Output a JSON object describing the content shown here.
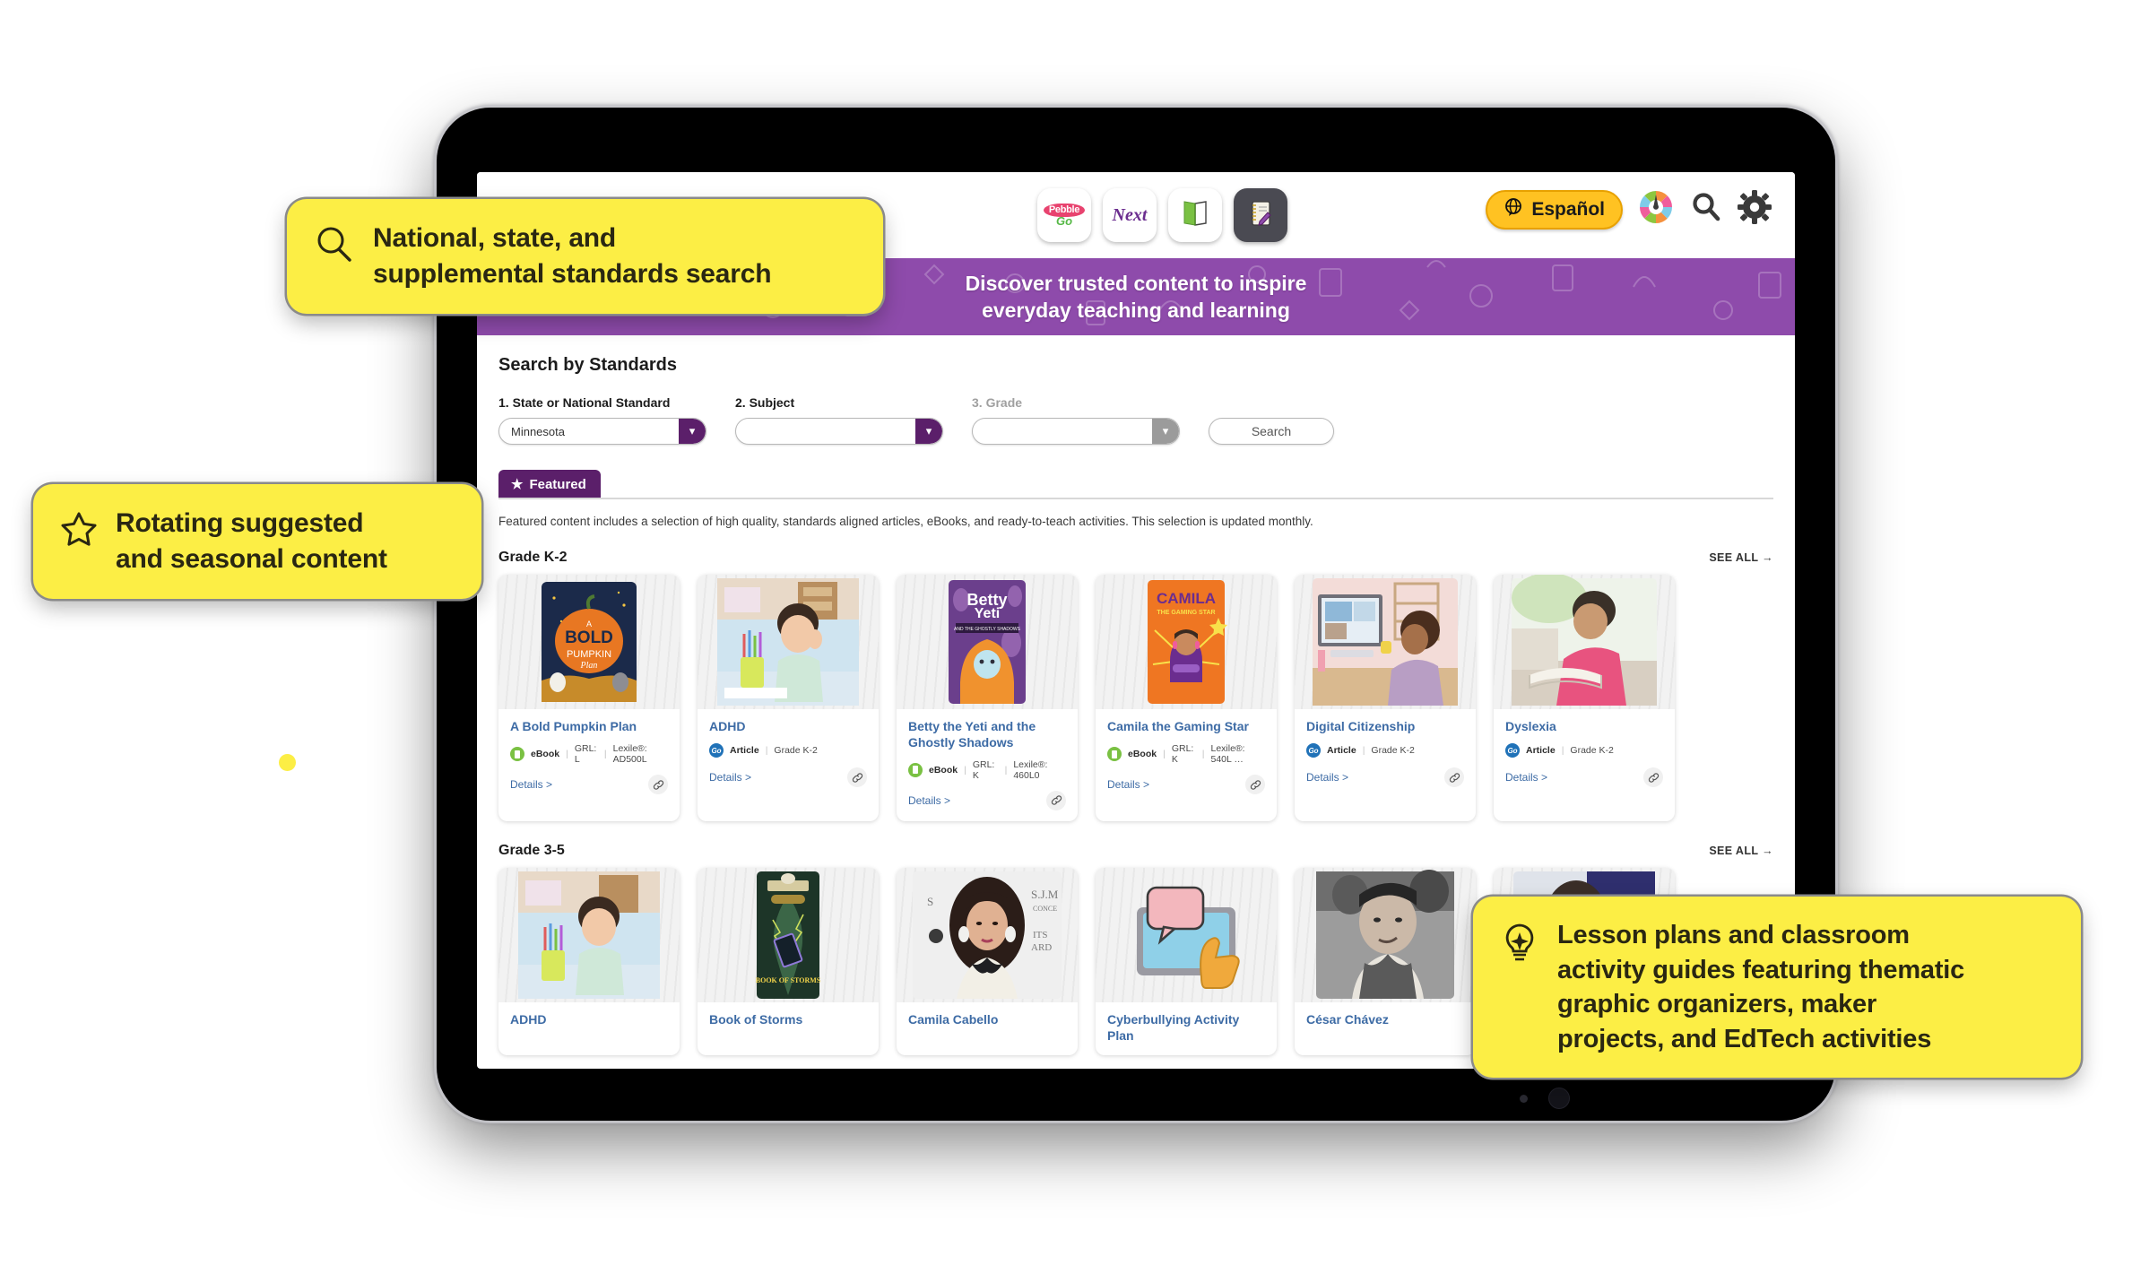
{
  "callouts": [
    {
      "id": "standards",
      "icon": "magnifier-icon",
      "lines": [
        "National, state, and",
        "supplemental standards search"
      ]
    },
    {
      "id": "rotating",
      "icon": "star-icon",
      "lines": [
        "Rotating suggested",
        "and seasonal content"
      ]
    },
    {
      "id": "lessons",
      "icon": "lightbulb-icon",
      "lines": [
        "Lesson plans and classroom",
        "activity guides featuring thematic",
        "graphic organizers, maker",
        "projects, and EdTech activities"
      ]
    }
  ],
  "header": {
    "brand_tiles": [
      {
        "name": "pebblego",
        "top": "Pebble",
        "bottom": "Go"
      },
      {
        "name": "next",
        "label": "Next"
      },
      {
        "name": "book",
        "label": ""
      },
      {
        "name": "notebook",
        "label": ""
      }
    ],
    "espanol_label": "Español",
    "icons": [
      "globe-icon",
      "color-wheel-icon",
      "search-icon",
      "gear-icon"
    ]
  },
  "hero": {
    "line1": "Discover trusted content to inspire",
    "line2": "everyday teaching and learning",
    "background_color": "#8e4bab"
  },
  "search_standards": {
    "title": "Search by Standards",
    "fields": [
      {
        "label": "1. State or National Standard",
        "value": "Minnesota",
        "placeholder": "",
        "disabled": false
      },
      {
        "label": "2. Subject",
        "value": "",
        "placeholder": "",
        "disabled": false
      },
      {
        "label": "3. Grade",
        "value": "",
        "placeholder": "",
        "disabled": true
      }
    ],
    "submit_label": "Search"
  },
  "featured": {
    "tab_label": "Featured",
    "tab_icon": "star-icon",
    "description": "Featured content includes a selection of high quality, standards aligned articles, eBooks, and ready-to-teach activities. This selection is updated monthly.",
    "see_all_label": "SEE ALL",
    "groups": [
      {
        "grade_label": "Grade K-2",
        "cards": [
          {
            "title": "A Bold Pumpkin Plan",
            "type": "eBook",
            "badge": "ebook",
            "meta1": "GRL: L",
            "meta2": "Lexile®: AD500L",
            "details_label": "Details",
            "art": "pumpkin"
          },
          {
            "title": "ADHD",
            "type": "Article",
            "badge": "go",
            "meta1": "Grade K-2",
            "meta2": "",
            "details_label": "Details",
            "art": "boy-desk"
          },
          {
            "title": "Betty the Yeti and the Ghostly Shadows",
            "type": "eBook",
            "badge": "ebook",
            "meta1": "GRL: K",
            "meta2": "Lexile®: 460L0",
            "details_label": "Details",
            "art": "yeti"
          },
          {
            "title": "Camila the Gaming Star",
            "type": "eBook",
            "badge": "ebook",
            "meta1": "GRL: K",
            "meta2": "Lexile®: 540L …",
            "details_label": "Details",
            "art": "camila-book"
          },
          {
            "title": "Digital Citizenship",
            "type": "Article",
            "badge": "go",
            "meta1": "Grade K-2",
            "meta2": "",
            "details_label": "Details",
            "art": "girl-computer"
          },
          {
            "title": "Dyslexia",
            "type": "Article",
            "badge": "go",
            "meta1": "Grade K-2",
            "meta2": "",
            "details_label": "Details",
            "art": "boy-reading"
          }
        ]
      },
      {
        "grade_label": "Grade 3-5",
        "cards": [
          {
            "title": "ADHD",
            "type": "",
            "badge": "",
            "meta1": "",
            "meta2": "",
            "details_label": "",
            "art": "boy-desk"
          },
          {
            "title": "Book of Storms",
            "type": "",
            "badge": "",
            "meta1": "",
            "meta2": "",
            "details_label": "",
            "art": "storms"
          },
          {
            "title": "Camila Cabello",
            "type": "",
            "badge": "",
            "meta1": "",
            "meta2": "",
            "details_label": "",
            "art": "camila-photo"
          },
          {
            "title": "Cyberbullying Activity Plan",
            "type": "",
            "badge": "",
            "meta1": "",
            "meta2": "",
            "details_label": "",
            "art": "cyberbullying"
          },
          {
            "title": "César Chávez",
            "type": "",
            "badge": "",
            "meta1": "",
            "meta2": "",
            "details_label": "",
            "art": "chavez"
          },
          {
            "title": "",
            "type": "",
            "badge": "",
            "meta1": "",
            "meta2": "",
            "details_label": "",
            "art": "person"
          }
        ]
      }
    ],
    "carousel_next_icon": "chevron-right-icon"
  },
  "colors": {
    "accent_yellow": "#fcee45",
    "banner_purple": "#8e4bab",
    "tab_purple": "#5b1f6a",
    "link_blue": "#3d6ba5",
    "espanol_orange": "#ffc222"
  }
}
